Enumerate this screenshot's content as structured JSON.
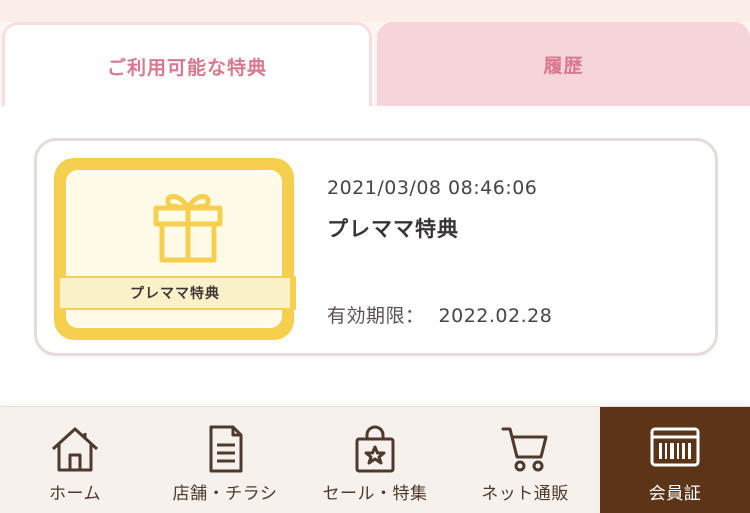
{
  "tabs": {
    "available_label": "ご利用可能な特典",
    "history_label": "履歴"
  },
  "coupon": {
    "badge_label": "プレママ特典",
    "datetime": "2021/03/08 08:46:06",
    "title": "プレママ特典",
    "expiry_label": "有効期限：",
    "expiry_value": "2022.02.28"
  },
  "nav": {
    "items": [
      {
        "label": "ホーム",
        "icon": "home-icon"
      },
      {
        "label": "店舗・チラシ",
        "icon": "flyer-icon"
      },
      {
        "label": "セール・特集",
        "icon": "shopping-bag-icon"
      },
      {
        "label": "ネット通販",
        "icon": "cart-icon"
      },
      {
        "label": "会員証",
        "icon": "barcode-card-icon"
      }
    ],
    "active_index": 4
  },
  "colors": {
    "accent_pink": "#d8798f",
    "badge_yellow": "#f5cf4d",
    "nav_active_brown": "#5c3418"
  }
}
